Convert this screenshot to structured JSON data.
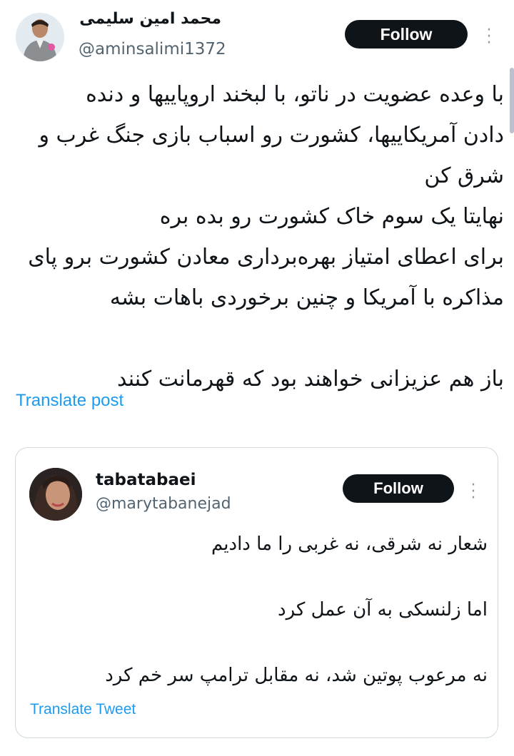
{
  "author": {
    "name": "محمد امین سلیمی",
    "handle": "@aminsalimi1372",
    "follow_label": "Follow",
    "more_icon": "more-vertical-icon"
  },
  "post": {
    "text": "با وعده عضویت در ناتو، با لبخند اروپاییها و دنده\nدادن آمریکاییها، کشورت رو اسباب بازی جنگ غرب و\nشرق کن\nنهایتا یک سوم خاک کشورت رو بده بره\nبرای اعطای امتیاز بهره‌برداری معادن کشورت برو پای\nمذاکره با آمریکا و چنین برخوردی باهات بشه\n\nباز هم عزیزانی خواهند بود که قهرمانت کنند",
    "translate_label": "Translate post"
  },
  "quoted": {
    "name": "tabatabaei",
    "handle": "@marytabanejad",
    "follow_label": "Follow",
    "text": "شعار نه شرقی، نه غربی را ما دادیم\n\nاما زلنسکی به آن عمل کرد\n\nنه مرعوب پوتین شد، نه مقابل ترامپ سر خم کرد",
    "translate_label": "Translate Tweet"
  },
  "colors": {
    "text": "#0f1419",
    "secondary": "#536471",
    "link": "#1d9bf0",
    "button_bg": "#0f1419",
    "border": "#cfd9de"
  }
}
